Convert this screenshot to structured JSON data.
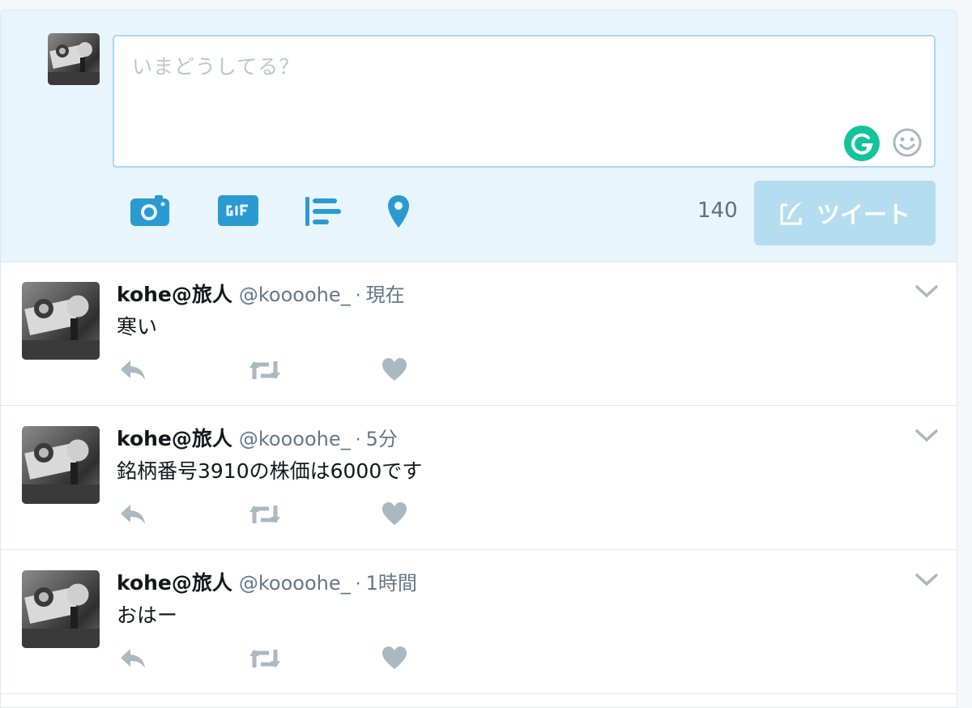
{
  "composer": {
    "placeholder": "いまどうしてる？",
    "char_count": "140",
    "tweet_label": "ツイート"
  },
  "colors": {
    "accent": "#1da1f2",
    "tool_icon": "#2b9ad1",
    "button_disabled": "#b4ddf0",
    "grammarly": "#15c39a",
    "action_icon": "#aab8c2"
  },
  "tweets": [
    {
      "name": "kohe@旅人",
      "handle": "@koooohe_",
      "dot": "·",
      "time": "現在",
      "text": "寒い"
    },
    {
      "name": "kohe@旅人",
      "handle": "@koooohe_",
      "dot": "·",
      "time": "5分",
      "text": "銘柄番号3910の株価は6000です"
    },
    {
      "name": "kohe@旅人",
      "handle": "@koooohe_",
      "dot": "·",
      "time": "1時間",
      "text": "おはー"
    }
  ]
}
